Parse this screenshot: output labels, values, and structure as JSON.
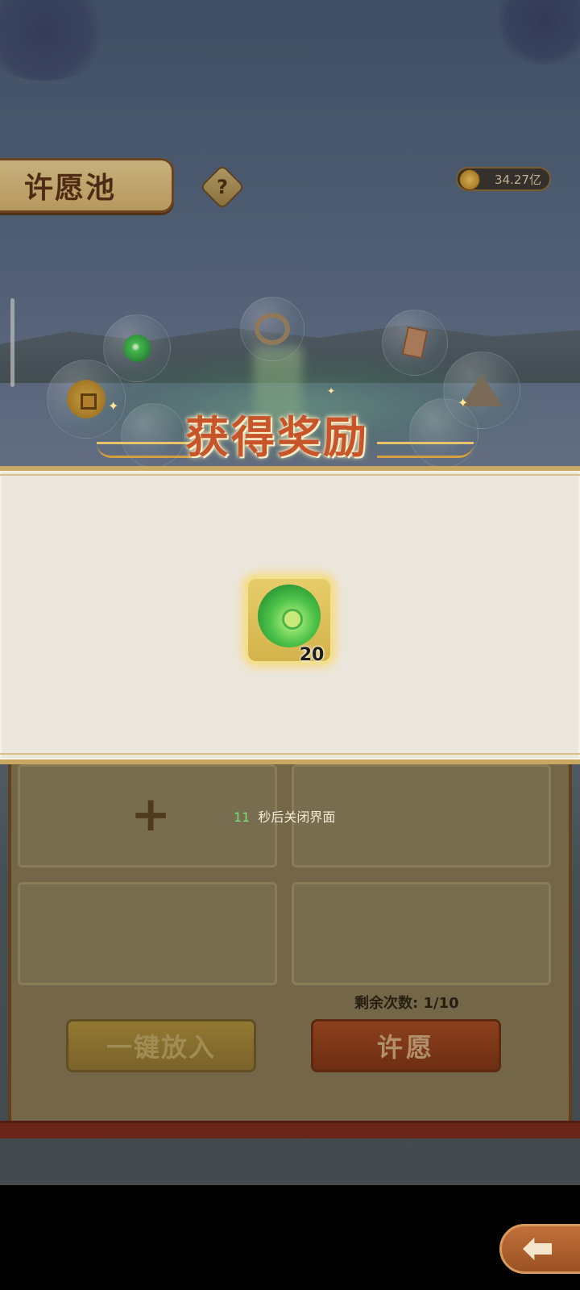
{
  "header": {
    "title": "许愿池",
    "help_label": "?",
    "currency_value": "34.27亿",
    "currency_icon": "coin-icon"
  },
  "reward_modal": {
    "title": "获得奖励",
    "item": {
      "icon": "jade-disc-icon",
      "count": "20"
    },
    "close_seconds": "11",
    "close_text": "秒后关闭界面"
  },
  "panel": {
    "plus_label": "+",
    "remaining_label": "剩余次数: 1/10",
    "fill_button": "一键放入",
    "wish_button": "许愿"
  },
  "colors": {
    "title_red": "#c8552a",
    "modal_bg": "#ebe7dc",
    "accent_gold": "#c9a863",
    "countdown_green": "#6fe07a"
  }
}
